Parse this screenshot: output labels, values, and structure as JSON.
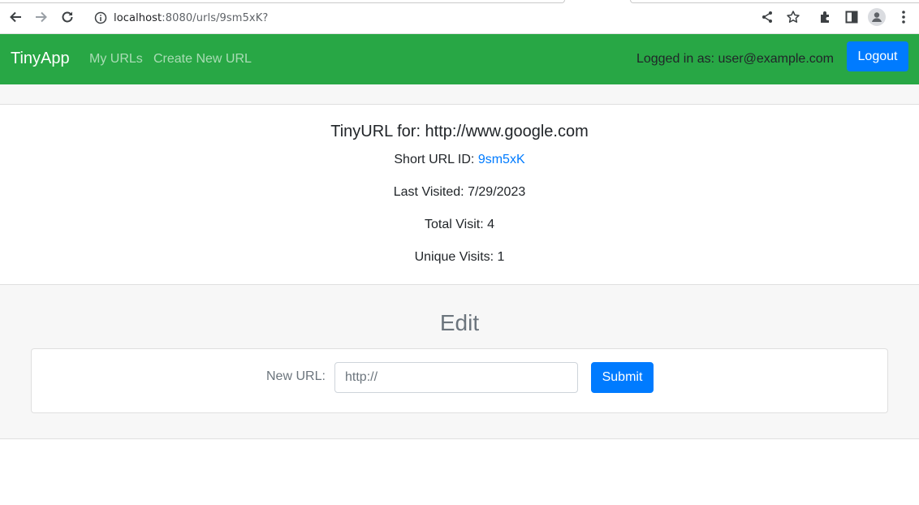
{
  "browser": {
    "url_host": "localhost",
    "url_rest": ":8080/urls/9sm5xK?",
    "icons": [
      "back-icon",
      "forward-icon",
      "reload-icon",
      "site-info-icon",
      "share-icon",
      "bookmark-star-icon",
      "extensions-icon",
      "side-panel-icon",
      "profile-icon",
      "menu-kebab-icon"
    ]
  },
  "navbar": {
    "brand": "TinyApp",
    "links": [
      "My URLs",
      "Create New URL"
    ],
    "logged_in_text": "Logged in as: user@example.com",
    "logout_label": "Logout",
    "color": "#28a745"
  },
  "info": {
    "title": "TinyURL for: http://www.google.com",
    "short_url_label": "Short URL ID: ",
    "short_url_id": "9sm5xK",
    "last_visited": "Last Visited: 7/29/2023",
    "total_visit": "Total Visit: 4",
    "unique_visits": "Unique Visits: 1"
  },
  "edit": {
    "title": "Edit",
    "new_url_label": "New URL:",
    "input_placeholder": "http://",
    "submit_label": "Submit"
  },
  "colors": {
    "primary": "#007bff",
    "success": "#28a745"
  }
}
